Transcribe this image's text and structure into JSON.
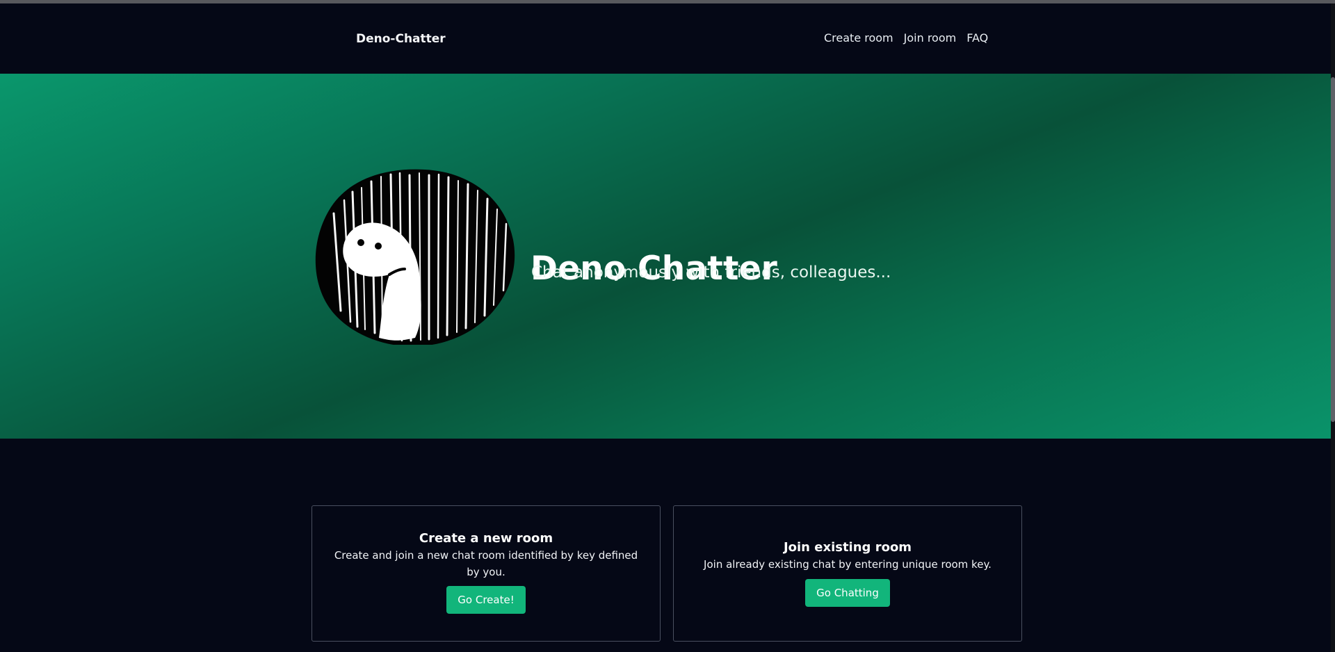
{
  "navbar": {
    "brand": "Deno-Chatter",
    "links": [
      {
        "label": "Create room"
      },
      {
        "label": "Join room"
      },
      {
        "label": "FAQ"
      }
    ]
  },
  "hero": {
    "title": "Deno Chatter",
    "subtitle": "Chat anonymously with friends, colleagues...",
    "gradient_colors": [
      "#0a976c",
      "#085239",
      "#0a936a"
    ]
  },
  "cards": [
    {
      "title": "Create a new room",
      "text": "Create and join a new chat room identified by key defined by you.",
      "button": "Go Create!"
    },
    {
      "title": "Join existing room",
      "text": "Join already existing chat by entering unique room key.",
      "button": "Go Chatting"
    }
  ],
  "colors": {
    "background": "#050816",
    "accent": "#12b57b",
    "card_border": "#4a5060"
  },
  "icons": {
    "mascot": "deno-dinosaur-icon"
  }
}
